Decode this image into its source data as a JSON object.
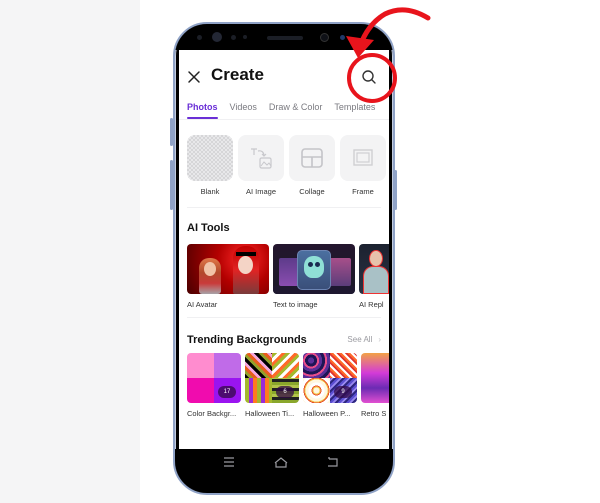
{
  "header": {
    "title": "Create",
    "close_icon": "close-icon",
    "search_icon": "search-icon"
  },
  "tabs": [
    {
      "label": "Photos",
      "active": true
    },
    {
      "label": "Videos",
      "active": false
    },
    {
      "label": "Draw & Color",
      "active": false
    },
    {
      "label": "Templates",
      "active": false
    }
  ],
  "quick_actions": [
    {
      "label": "Blank",
      "icon": "checkerboard"
    },
    {
      "label": "AI Image",
      "icon": "text-to-image-icon"
    },
    {
      "label": "Collage",
      "icon": "collage-icon"
    },
    {
      "label": "Frame",
      "icon": "frame-icon"
    }
  ],
  "ai_tools": {
    "title": "AI Tools",
    "items": [
      {
        "label": "AI Avatar"
      },
      {
        "label": "Text to image"
      },
      {
        "label": "AI Repl"
      }
    ]
  },
  "trending_backgrounds": {
    "title": "Trending Backgrounds",
    "see_all": "See All",
    "items": [
      {
        "label": "Color Backgr...",
        "count": "17"
      },
      {
        "label": "Halloween Ti...",
        "count": "6"
      },
      {
        "label": "Halloween P...",
        "count": "9"
      },
      {
        "label": "Retro S",
        "count": ""
      }
    ]
  },
  "annotation": {
    "color": "#e8141c",
    "target": "search-button"
  },
  "colors": {
    "accent": "#6a2fd6",
    "phone_frame": "#8fa2c6"
  }
}
